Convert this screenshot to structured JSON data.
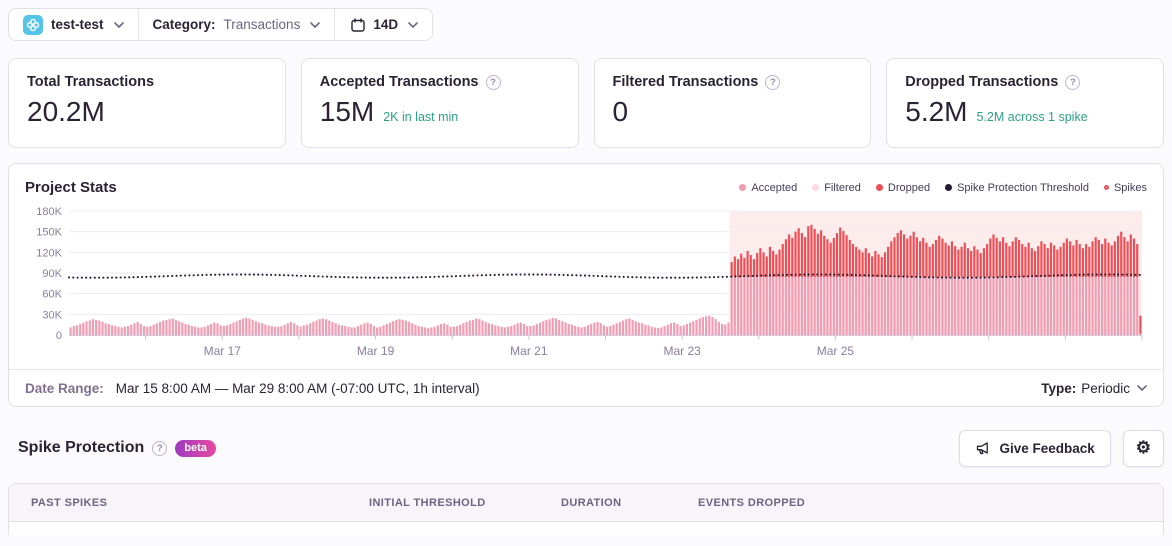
{
  "topbar": {
    "project_name": "test-test",
    "category_label": "Category:",
    "category_value": "Transactions",
    "date_period": "14D"
  },
  "cards": [
    {
      "title": "Total Transactions",
      "value": "20.2M",
      "sub": ""
    },
    {
      "title": "Accepted Transactions",
      "value": "15M",
      "sub": "2K in last min"
    },
    {
      "title": "Filtered Transactions",
      "value": "0",
      "sub": ""
    },
    {
      "title": "Dropped Transactions",
      "value": "5.2M",
      "sub": "5.2M across 1 spike"
    }
  ],
  "help_glyph": "?",
  "chart_data": {
    "type": "bar",
    "title": "Project Stats",
    "unit": "K",
    "ylim": [
      0,
      180
    ],
    "yticks": [
      0,
      30,
      60,
      90,
      120,
      150,
      180
    ],
    "days": 14,
    "interval_hours": 1,
    "xtick_labels": [
      {
        "day": 2,
        "label": "Mar 17"
      },
      {
        "day": 4,
        "label": "Mar 19"
      },
      {
        "day": 6,
        "label": "Mar 21"
      },
      {
        "day": 8,
        "label": "Mar 23"
      },
      {
        "day": 10,
        "label": "Mar 25"
      }
    ],
    "threshold_k": 84,
    "spike_start_index": 207,
    "accepted_pre_spike_k": [
      11,
      13,
      14,
      16,
      18,
      20,
      21,
      23,
      22,
      21,
      19,
      17,
      16,
      14,
      13,
      12,
      11,
      12,
      13,
      15,
      17,
      19,
      16,
      13,
      12,
      13,
      15,
      17,
      19,
      21,
      22,
      23,
      24,
      22,
      20,
      18,
      16,
      15,
      13,
      12,
      11,
      11,
      12,
      14,
      16,
      18,
      17,
      14,
      13,
      14,
      16,
      18,
      20,
      22,
      24,
      25,
      24,
      22,
      20,
      18,
      17,
      15,
      14,
      13,
      12,
      12,
      13,
      15,
      17,
      19,
      17,
      14,
      12,
      14,
      15,
      17,
      19,
      21,
      23,
      24,
      23,
      21,
      19,
      17,
      15,
      14,
      13,
      12,
      11,
      11,
      13,
      15,
      17,
      18,
      16,
      13,
      11,
      12,
      14,
      16,
      18,
      20,
      22,
      23,
      22,
      21,
      19,
      17,
      15,
      13,
      12,
      11,
      10,
      11,
      12,
      14,
      16,
      17,
      15,
      12,
      12,
      13,
      15,
      17,
      19,
      21,
      22,
      24,
      23,
      21,
      19,
      17,
      16,
      14,
      13,
      12,
      11,
      12,
      13,
      15,
      17,
      18,
      16,
      13,
      13,
      14,
      16,
      18,
      20,
      22,
      23,
      25,
      24,
      22,
      20,
      18,
      16,
      15,
      13,
      12,
      11,
      12,
      14,
      16,
      18,
      19,
      17,
      14,
      12,
      13,
      15,
      17,
      19,
      21,
      23,
      24,
      22,
      20,
      18,
      17,
      15,
      14,
      12,
      11,
      10,
      11,
      13,
      15,
      17,
      18,
      16,
      13,
      14,
      16,
      18,
      20,
      22,
      24,
      26,
      27,
      28,
      26,
      23,
      19,
      16,
      15,
      18
    ],
    "accepted_during_spike_k": 84,
    "dropped_during_spike_k": [
      22,
      30,
      26,
      34,
      28,
      38,
      32,
      26,
      35,
      42,
      36,
      30,
      44,
      38,
      33,
      40,
      48,
      55,
      62,
      57,
      66,
      71,
      64,
      58,
      74,
      76,
      70,
      63,
      68,
      60,
      55,
      50,
      57,
      64,
      72,
      67,
      61,
      54,
      48,
      44,
      40,
      36,
      42,
      35,
      30,
      38,
      33,
      29,
      36,
      44,
      52,
      58,
      64,
      68,
      62,
      56,
      60,
      66,
      58,
      52,
      57,
      50,
      44,
      48,
      54,
      60,
      56,
      50,
      46,
      52,
      45,
      40,
      44,
      50,
      42,
      38,
      45,
      40,
      35,
      42,
      48,
      56,
      62,
      57,
      52,
      58,
      50,
      45,
      52,
      58,
      54,
      48,
      44,
      50,
      42,
      38,
      45,
      52,
      48,
      42,
      50,
      46,
      40,
      44,
      50,
      56,
      52,
      46,
      54,
      48,
      42,
      48,
      44,
      52,
      58,
      54,
      48,
      56,
      50,
      46,
      52,
      60,
      66,
      58,
      52,
      62,
      56,
      48
    ],
    "last_bar": {
      "accepted_k": 2,
      "dropped_k": 26
    },
    "legend": [
      {
        "label": "Accepted",
        "style": "dot",
        "color": "#f29cb3"
      },
      {
        "label": "Filtered",
        "style": "dot",
        "color": "#fbd9e4"
      },
      {
        "label": "Dropped",
        "style": "dot",
        "color": "#ee4f56"
      },
      {
        "label": "Spike Protection Threshold",
        "style": "dot",
        "color": "#241a30"
      },
      {
        "label": "Spikes",
        "style": "ring",
        "color": "#ee4f56"
      }
    ],
    "colors": {
      "accepted": "#f29cb3",
      "dropped": "#ee4f56",
      "threshold": "#241a30",
      "spike_region": "#fcecec",
      "grid": "#f0ebf4",
      "axis": "#d6c9de",
      "tick": "#cbbcd5",
      "axis_text": "#8d7d9c"
    }
  },
  "date_range": {
    "label": "Date Range:",
    "value": "Mar 15 8:00 AM — Mar 29 8:00 AM (-07:00 UTC, 1h interval)",
    "type_label": "Type:",
    "type_value": "Periodic"
  },
  "spike_section": {
    "title": "Spike Protection",
    "badge_label": "beta",
    "feedback_button": "Give Feedback",
    "gear_glyph": "⚙"
  },
  "table": {
    "headers": [
      "PAST SPIKES",
      "INITIAL THRESHOLD",
      "DURATION",
      "EVENTS DROPPED"
    ]
  }
}
